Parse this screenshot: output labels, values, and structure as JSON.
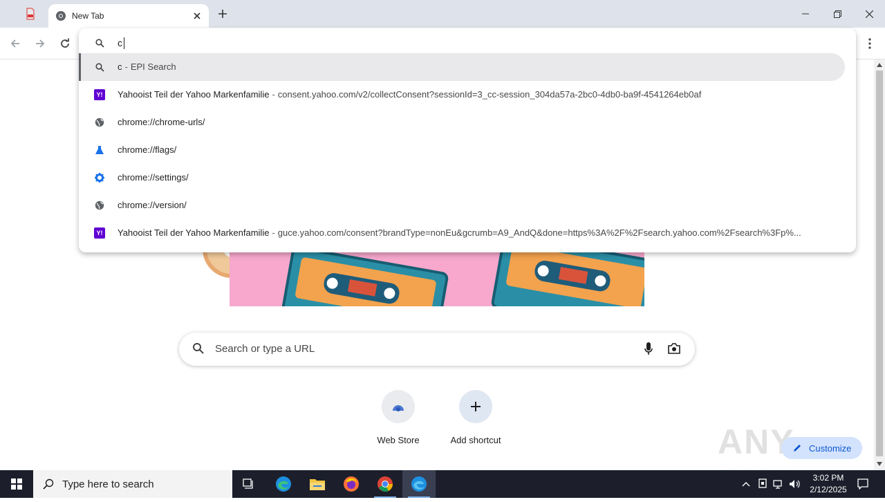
{
  "browser": {
    "tabs": [
      {
        "label": "",
        "icon": "pdf-icon",
        "active": false
      },
      {
        "label": "New Tab",
        "icon": "chrome-icon",
        "active": true
      }
    ],
    "omnibox": {
      "input_value": "c",
      "suggestions": [
        {
          "icon": "search-icon",
          "title": "c",
          "separator": "-",
          "detail": "EPI Search",
          "selected": true
        },
        {
          "icon": "yahoo-icon",
          "title": "Yahooist Teil der Yahoo Markenfamilie",
          "separator": "-",
          "detail": "consent.yahoo.com/v2/collectConsent?sessionId=3_cc-session_304da57a-2bc0-4db0-ba9f-4541264eb0af",
          "selected": false
        },
        {
          "icon": "globe-icon",
          "title": "chrome://chrome-urls/",
          "separator": "",
          "detail": "",
          "selected": false
        },
        {
          "icon": "flask-icon",
          "title": "chrome://flags/",
          "separator": "",
          "detail": "",
          "selected": false
        },
        {
          "icon": "gear-icon",
          "title": "chrome://settings/",
          "separator": "",
          "detail": "",
          "selected": false
        },
        {
          "icon": "globe-icon",
          "title": "chrome://version/",
          "separator": "",
          "detail": "",
          "selected": false
        },
        {
          "icon": "yahoo-icon",
          "title": "Yahooist Teil der Yahoo Markenfamilie",
          "separator": "-",
          "detail": "guce.yahoo.com/consent?brandType=nonEu&gcrumb=A9_AndQ&done=https%3A%2F%2Fsearch.yahoo.com%2Fsearch%3Fp%...",
          "selected": false
        }
      ]
    }
  },
  "ntp": {
    "search_placeholder": "Search or type a URL",
    "shortcuts": [
      {
        "label": "Web Store",
        "icon": "webstore-icon"
      },
      {
        "label": "Add shortcut",
        "icon": "plus-icon"
      }
    ],
    "customize_label": "Customize",
    "watermark": "ANY RUN"
  },
  "taskbar": {
    "search_placeholder": "Type here to search",
    "time": "3:02 PM",
    "date": "2/12/2025"
  },
  "colors": {
    "titlebar": "#dee3eb",
    "yahoo": "#6001d2",
    "accent": "#0b57d0",
    "taskbar": "#1c1f2b"
  }
}
